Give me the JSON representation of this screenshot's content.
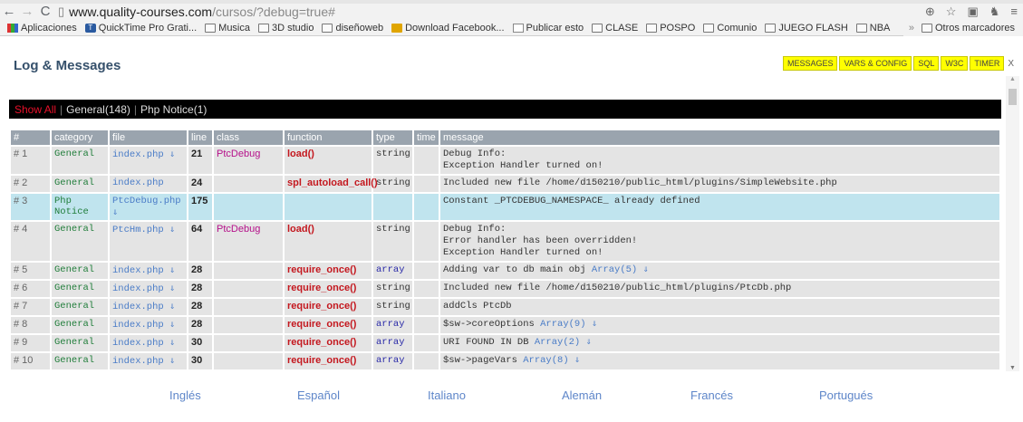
{
  "browser": {
    "url_host": "www.quality-courses.com",
    "url_path": "/cursos/?debug=true#",
    "bookmarks": [
      {
        "label": "Aplicaciones",
        "icon": "apps-grid-icon"
      },
      {
        "label": "QuickTime Pro Grati...",
        "icon": "quicktime-icon"
      },
      {
        "label": "Musica",
        "icon": "folder-icon"
      },
      {
        "label": "3D studio",
        "icon": "folder-icon"
      },
      {
        "label": "diseñoweb",
        "icon": "folder-icon"
      },
      {
        "label": "Download Facebook...",
        "icon": "gift-icon"
      },
      {
        "label": "Publicar esto",
        "icon": "page-icon"
      },
      {
        "label": "CLASE",
        "icon": "folder-icon"
      },
      {
        "label": "POSPO",
        "icon": "folder-icon"
      },
      {
        "label": "Comunio",
        "icon": "folder-icon"
      },
      {
        "label": "JUEGO FLASH",
        "icon": "folder-icon"
      },
      {
        "label": "NBA",
        "icon": "folder-icon"
      }
    ],
    "bookmarks_overflow": "»",
    "other_bookmarks": "Otros marcadores"
  },
  "debug": {
    "title": "Log & Messages",
    "tabs": [
      "MESSAGES",
      "VARS & CONFIG",
      "SQL",
      "W3C",
      "TIMER"
    ],
    "close_label": "X",
    "filters": {
      "show_all": "Show All",
      "general": "General(148)",
      "php_notice": "Php Notice(1)"
    },
    "columns": [
      "#",
      "category",
      "file",
      "line",
      "class",
      "function",
      "type",
      "time",
      "message"
    ],
    "rows": [
      {
        "n": "# 1",
        "category": "General",
        "file": "index.php ⇓",
        "line": "21",
        "class": "PtcDebug",
        "function": "load()",
        "type": "string",
        "time": "",
        "message": "Debug Info:\nException Handler turned on!",
        "link": ""
      },
      {
        "n": "# 2",
        "category": "General",
        "file": "index.php",
        "line": "24",
        "class": "",
        "function": "spl_autoload_call()",
        "type": "string",
        "time": "",
        "message": "Included new file /home/d150210/public_html/plugins/SimpleWebsite.php",
        "link": ""
      },
      {
        "n": "# 3",
        "category": "Php Notice",
        "file": "PtcDebug.php ⇓",
        "line": "175",
        "class": "",
        "function": "",
        "type": "",
        "time": "",
        "message": "Constant _PTCDEBUG_NAMESPACE_ already defined",
        "link": "",
        "highlight": true
      },
      {
        "n": "# 4",
        "category": "General",
        "file": "PtcHm.php ⇓",
        "line": "64",
        "class": "PtcDebug",
        "function": "load()",
        "type": "string",
        "time": "",
        "message": "Debug Info:\nError handler has been overridden!\nException Handler turned on!",
        "link": ""
      },
      {
        "n": "# 5",
        "category": "General",
        "file": "index.php ⇓",
        "line": "28",
        "class": "",
        "function": "require_once()",
        "type": "array",
        "time": "",
        "message": "Adding var to db main obj ",
        "link": "Array(5) ⇓"
      },
      {
        "n": "# 6",
        "category": "General",
        "file": "index.php ⇓",
        "line": "28",
        "class": "",
        "function": "require_once()",
        "type": "string",
        "time": "",
        "message": "Included new file /home/d150210/public_html/plugins/PtcDb.php",
        "link": ""
      },
      {
        "n": "# 7",
        "category": "General",
        "file": "index.php ⇓",
        "line": "28",
        "class": "",
        "function": "require_once()",
        "type": "string",
        "time": "",
        "message": "addCls PtcDb",
        "link": ""
      },
      {
        "n": "# 8",
        "category": "General",
        "file": "index.php ⇓",
        "line": "28",
        "class": "",
        "function": "require_once()",
        "type": "array",
        "time": "",
        "message": "$sw->coreOptions ",
        "link": "Array(9) ⇓"
      },
      {
        "n": "# 9",
        "category": "General",
        "file": "index.php ⇓",
        "line": "30",
        "class": "",
        "function": "require_once()",
        "type": "array",
        "time": "",
        "message": "URI FOUND IN DB ",
        "link": "Array(2) ⇓"
      },
      {
        "n": "# 10",
        "category": "General",
        "file": "index.php ⇓",
        "line": "30",
        "class": "",
        "function": "require_once()",
        "type": "array",
        "time": "",
        "message": "$sw->pageVars ",
        "link": "Array(8) ⇓"
      }
    ]
  },
  "languages": [
    "Inglés",
    "Español",
    "Italiano",
    "Alemán",
    "Francés",
    "Portugués"
  ]
}
